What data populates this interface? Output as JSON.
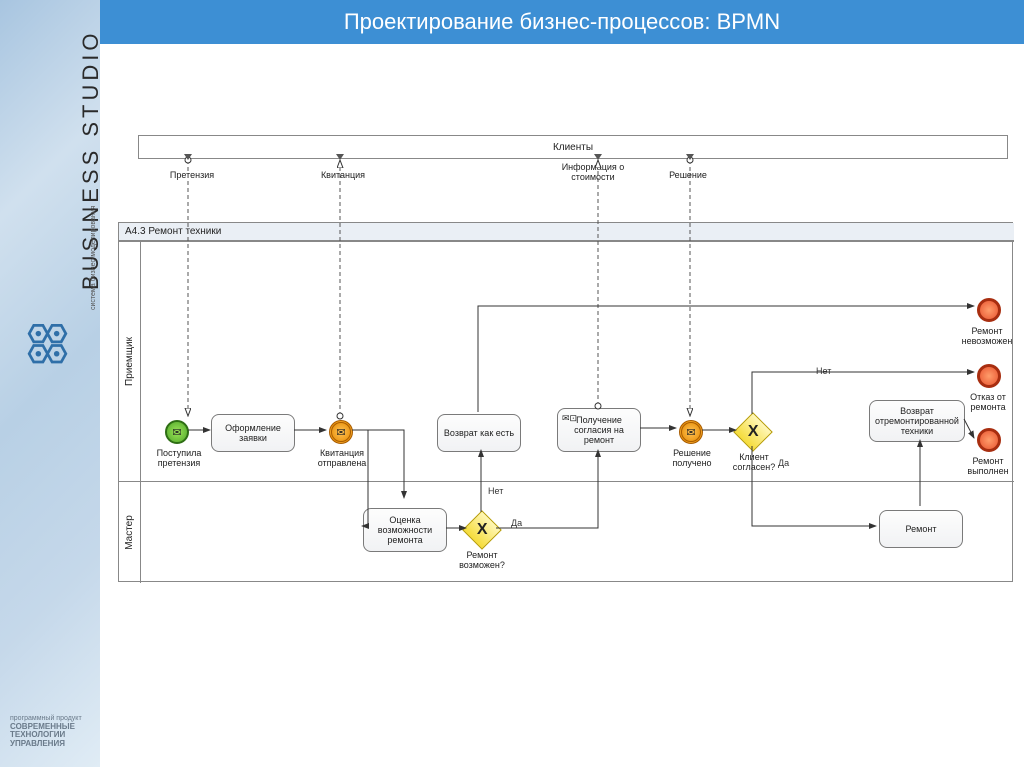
{
  "header": {
    "title": "Проектирование бизнес-процессов: BPMN"
  },
  "brand": {
    "name": "BUSINESS STUDIO",
    "tagline": "система бизнес-моделирования",
    "footer1": "программный продукт",
    "footer2": "СОВРЕМЕННЫЕ",
    "footer3": "ТЕХНОЛОГИИ",
    "footer4": "УПРАВЛЕНИЯ"
  },
  "external": {
    "clients": "Клиенты",
    "messages": {
      "claim": "Претензия",
      "receipt": "Квитанция",
      "costinfo": "Информация о стоимости",
      "decision": "Решение"
    }
  },
  "pool": {
    "title": "A4.3 Ремонт техники",
    "lanes": {
      "receiver": "Приемщик",
      "master": "Мастер"
    }
  },
  "events": {
    "start": "Поступила претензия",
    "receipt_sent": "Квитанция отправлена",
    "decision_received": "Решение получено",
    "end_impossible": "Ремонт невозможен",
    "end_refusal": "Отказ от ремонта",
    "end_done": "Ремонт выполнен"
  },
  "tasks": {
    "register": "Оформление заявки",
    "assess": "Оценка возможности ремонта",
    "return_asis": "Возврат как есть",
    "consent": "Получение согласия на ремонт",
    "repair": "Ремонт",
    "return_fixed": "Возврат отремонтированной техники"
  },
  "gateways": {
    "repair_possible": "Ремонт возможен?",
    "client_agrees": "Клиент согласен?"
  },
  "edge_labels": {
    "yes": "Да",
    "no": "Нет"
  }
}
